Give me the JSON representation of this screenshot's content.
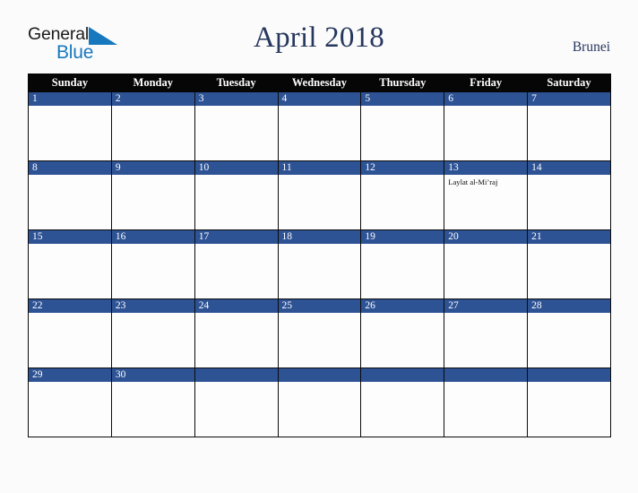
{
  "brand": {
    "name_part1": "General",
    "name_part2": "Blue",
    "triangle_color": "#1878be",
    "text_color": "#1b1b1b",
    "blue_color": "#1878be"
  },
  "header": {
    "title": "April 2018",
    "country": "Brunei",
    "title_color": "#26375e"
  },
  "theme": {
    "header_row_bg": "#060606",
    "day_band_bg": "#2e5395",
    "day_number_color": "#ffffff",
    "cell_bg": "#fdfdfd",
    "page_bg": "#fbfbfb",
    "grid_line_color": "#0b0b0b"
  },
  "calendar": {
    "month": "April",
    "year": "2018",
    "weekday_headers": [
      "Sunday",
      "Monday",
      "Tuesday",
      "Wednesday",
      "Thursday",
      "Friday",
      "Saturday"
    ],
    "weeks": [
      [
        {
          "day": "1",
          "events": []
        },
        {
          "day": "2",
          "events": []
        },
        {
          "day": "3",
          "events": []
        },
        {
          "day": "4",
          "events": []
        },
        {
          "day": "5",
          "events": []
        },
        {
          "day": "6",
          "events": []
        },
        {
          "day": "7",
          "events": []
        }
      ],
      [
        {
          "day": "8",
          "events": []
        },
        {
          "day": "9",
          "events": []
        },
        {
          "day": "10",
          "events": []
        },
        {
          "day": "11",
          "events": []
        },
        {
          "day": "12",
          "events": []
        },
        {
          "day": "13",
          "events": [
            "Laylat al-Mi’raj"
          ]
        },
        {
          "day": "14",
          "events": []
        }
      ],
      [
        {
          "day": "15",
          "events": []
        },
        {
          "day": "16",
          "events": []
        },
        {
          "day": "17",
          "events": []
        },
        {
          "day": "18",
          "events": []
        },
        {
          "day": "19",
          "events": []
        },
        {
          "day": "20",
          "events": []
        },
        {
          "day": "21",
          "events": []
        }
      ],
      [
        {
          "day": "22",
          "events": []
        },
        {
          "day": "23",
          "events": []
        },
        {
          "day": "24",
          "events": []
        },
        {
          "day": "25",
          "events": []
        },
        {
          "day": "26",
          "events": []
        },
        {
          "day": "27",
          "events": []
        },
        {
          "day": "28",
          "events": []
        }
      ],
      [
        {
          "day": "29",
          "events": []
        },
        {
          "day": "30",
          "events": []
        },
        {
          "day": "",
          "events": []
        },
        {
          "day": "",
          "events": []
        },
        {
          "day": "",
          "events": []
        },
        {
          "day": "",
          "events": []
        },
        {
          "day": "",
          "events": []
        }
      ]
    ]
  }
}
